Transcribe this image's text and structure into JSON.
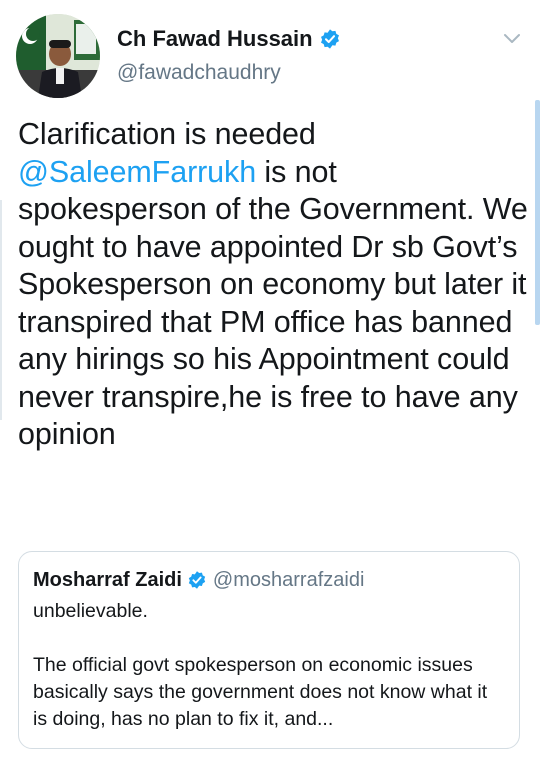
{
  "tweet": {
    "author": {
      "display_name": "Ch Fawad Hussain",
      "handle": "@fawadchaudhry",
      "verified": true
    },
    "text_parts": {
      "line1": "Clarification is needed",
      "mention": "@SaleemFarrukh",
      "rest": " is not spokesperson of the Government. We ought to have appointed Dr sb Govt’s Spokesperson on economy but later it transpired that PM office has banned any hirings so his Appointment could never transpire,he is free to have any opinion"
    },
    "icons": {
      "verified": "verified-badge-icon",
      "caret": "chevron-down-icon"
    },
    "colors": {
      "accent": "#1da1f2",
      "secondary_text": "#657786",
      "primary_text": "#14171a",
      "border": "#d4dde3"
    }
  },
  "quoted_tweet": {
    "display_name": "Mosharraf Zaidi",
    "handle": "@mosharrafzaidi",
    "verified": true,
    "text_line1": "unbelievable.",
    "text_para2": "The official govt spokesperson on economic issues basically says the government does not know what it is doing, has no plan to fix it, and..."
  }
}
